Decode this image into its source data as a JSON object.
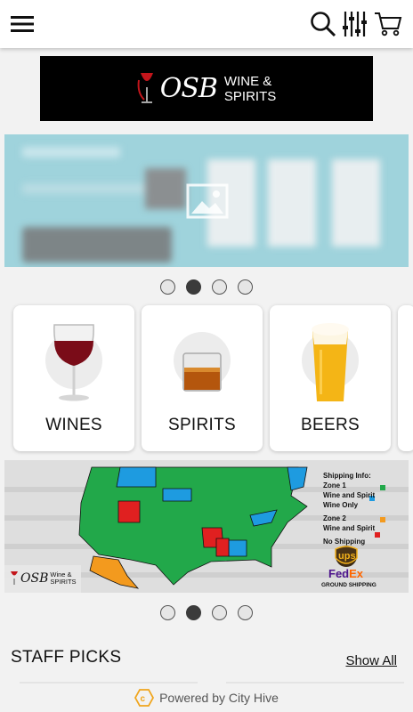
{
  "header": {
    "menu_icon": "hamburger-menu-icon",
    "search_icon": "search-icon",
    "filter_icon": "filter-sliders-icon",
    "cart_icon": "shopping-cart-icon"
  },
  "store": {
    "logo_initials": "OSB",
    "logo_line1": "WINE &",
    "logo_line2": "SPIRITS"
  },
  "hero_carousel": {
    "image_icon": "image-placeholder-icon",
    "slide_count": 4,
    "active_index": 1
  },
  "categories": [
    {
      "label": "WINES",
      "icon": "wine-glass-icon"
    },
    {
      "label": "SPIRITS",
      "icon": "whiskey-glass-icon"
    },
    {
      "label": "BEERS",
      "icon": "beer-glass-icon"
    }
  ],
  "shipping_banner": {
    "title": "Shipping Info:",
    "zone1": "Zone 1",
    "zone1_wine_spirit": "Wine and Spirit",
    "wine_only": "Wine Only",
    "zone2": "Zone 2",
    "zone2_wine_spirit": "Wine and Spirit",
    "no_shipping": "No Shipping",
    "carrier1": "ups",
    "carrier2_a": "Fed",
    "carrier2_b": "Ex",
    "ground": "GROUND SHIPPING",
    "logo_initials": "OSB",
    "logo_line1": "Wine &",
    "logo_line2": "SPIRITS",
    "colors": {
      "zone1": "#22a84a",
      "wine_only": "#1e9be0",
      "zone2": "#f39a1e",
      "no_shipping": "#e02020"
    }
  },
  "shipping_carousel": {
    "slide_count": 4,
    "active_index": 1
  },
  "staff_picks": {
    "title": "STAFF PICKS",
    "show_all": "Show All"
  },
  "footer": {
    "text": "Powered by City Hive",
    "icon": "city-hive-logo-icon"
  }
}
